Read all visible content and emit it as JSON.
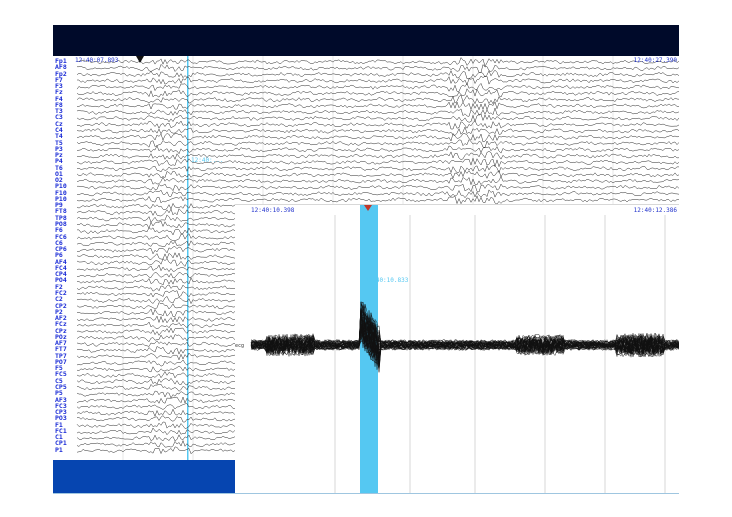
{
  "header": {
    "bar_color": "#000a2a"
  },
  "main_view": {
    "start_time": "12:40:07.893",
    "end_time": "12:40:27.390",
    "cursor_label": "12:40:...",
    "channels": [
      "Fp1",
      "AF8",
      "Fp2",
      "F7",
      "F3",
      "Fz",
      "F4",
      "F8",
      "T3",
      "C3",
      "Cz",
      "C4",
      "T4",
      "T5",
      "P3",
      "Pz",
      "P4",
      "T6",
      "O1",
      "O2",
      "P10",
      "F10",
      "P10",
      "P9",
      "FT8",
      "TP8",
      "PO8",
      "F6",
      "FC6",
      "C6",
      "CP6",
      "P6",
      "AF4",
      "FC4",
      "CP4",
      "PO4",
      "F2",
      "FC2",
      "C2",
      "CP2",
      "P2",
      "AF2",
      "FCz",
      "CPz",
      "POz",
      "AF7",
      "FT7",
      "TP7",
      "PO7",
      "F5",
      "FC5",
      "C5",
      "CP5",
      "P5",
      "AF3",
      "FC3",
      "CP3",
      "PO3",
      "F1",
      "FC1",
      "C1",
      "CP1",
      "P1"
    ]
  },
  "zoom_view": {
    "start_time": "12:40:10.398",
    "end_time": "12:40:12.386",
    "peak_label": "12:40:10.833",
    "ecg_label": "ecg"
  },
  "colors": {
    "highlight": "#55c8f2",
    "label_blue": "#1a2bd6",
    "bottom_bar": "#0645b0",
    "trace": "#111111"
  }
}
